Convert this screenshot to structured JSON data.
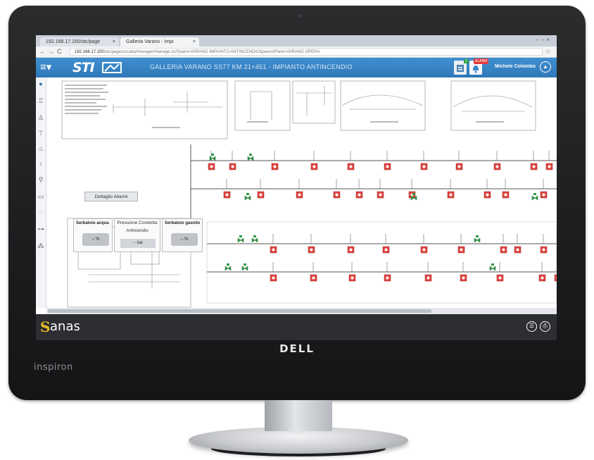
{
  "device": {
    "brand": "DELL",
    "model": "inspiron"
  },
  "browser": {
    "tabs": [
      {
        "label": "192.168.17.150/stc/page"
      },
      {
        "label": "Galleria Varano - Impi"
      }
    ],
    "url_host": "192.168.17.150",
    "url_path": "/stc/pages/scada/manager/manage.zul?plant=VARANO IMPIANTO ANTINCENDIO&parentPlant=VARANO OPERA"
  },
  "app": {
    "logo": "STI",
    "title": "GALLERIA VARANO SS77 KM 21+451 - IMPIANTO ANTINCENDIO",
    "user": "Michele Colombo",
    "notification_count": "1",
    "alarm_badge": "ALARM"
  },
  "sidebar": {
    "icons": [
      "home-icon",
      "hydrant-icon",
      "pump-icon",
      "valve-icon",
      "fire-icon",
      "bulb-icon",
      "lamp-icon",
      "battery-icon",
      "sensor-icon",
      "pipe-icon",
      "network-icon"
    ]
  },
  "diagram": {
    "details_button": "Dettaglio Allarmi",
    "tank_water": {
      "title": "Serbatoio acqua",
      "value": "-- %"
    },
    "pressure": {
      "title": "Pressione Condotta",
      "subtitle": "Antincendio",
      "value": "-- bar"
    },
    "tank_foam": {
      "title": "Serbatoio gasolio",
      "value": "-- %"
    }
  },
  "footer": {
    "brand": "anas",
    "brand_mark": "S"
  },
  "colors": {
    "header_blue": "#3a86c8",
    "hydrant_red": "#e0453f",
    "valve_green": "#2f9a46"
  }
}
